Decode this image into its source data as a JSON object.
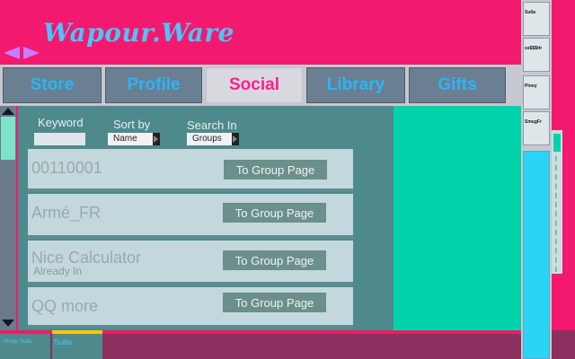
{
  "app": {
    "title": "Wapour.Ware"
  },
  "tabs": [
    {
      "label": "Store",
      "active": false
    },
    {
      "label": "Profile",
      "active": false
    },
    {
      "label": "Social",
      "active": true
    },
    {
      "label": "Library",
      "active": false
    },
    {
      "label": "Gifts",
      "active": false
    }
  ],
  "search": {
    "keyword_label": "Keyword",
    "keyword_value": "",
    "sort_label": "Sort by",
    "sort_value": "Name",
    "search_in_label": "Search In",
    "search_in_value": "Groups"
  },
  "groups": [
    {
      "name": "00110001",
      "sub": "",
      "button": "To Group Page"
    },
    {
      "name": "Armé_FR",
      "sub": "",
      "button": "To Group Page"
    },
    {
      "name": "Nice Calculator",
      "sub": "Already In",
      "button": "To Group Page"
    },
    {
      "name": "QQ more",
      "sub": "",
      "button": "To Group Page"
    }
  ],
  "bottom": {
    "chat_a": "Pinoy, Sulla",
    "chat_b": "Sulla"
  },
  "friends": [
    {
      "name": "Sulla"
    },
    {
      "name": "ss$$$ttr"
    },
    {
      "name": "Pinoy"
    },
    {
      "name": "SmugFr"
    }
  ],
  "colors": {
    "background": "#f2196f",
    "accent": "#4fc3f7",
    "active_tab_text": "#ff1e8c",
    "panel": "#4e8a8c",
    "side_panel": "#00d3a9"
  }
}
